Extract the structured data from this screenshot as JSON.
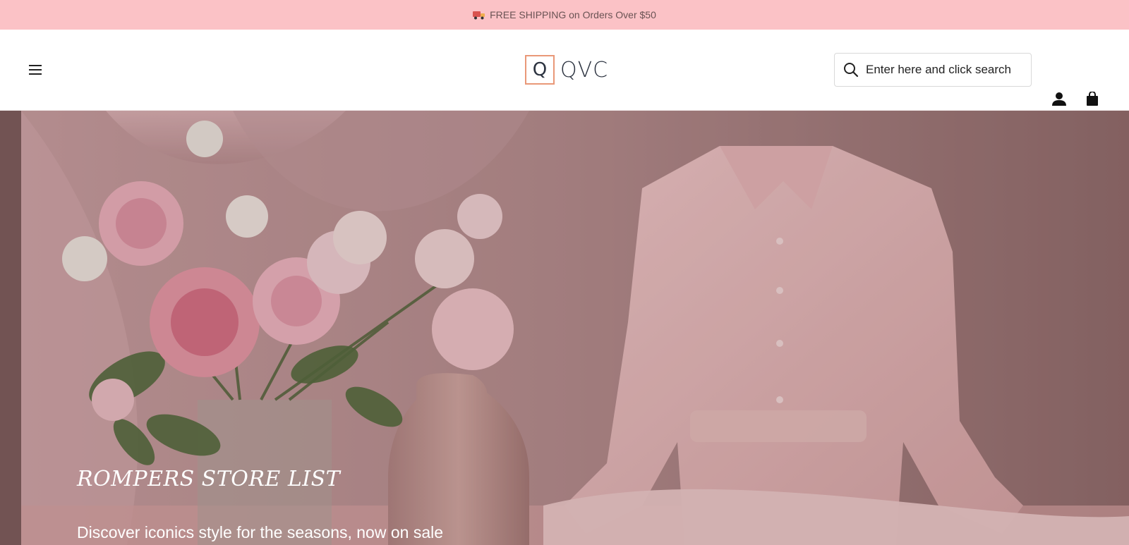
{
  "announcement": {
    "text": "FREE SHIPPING on Orders Over $50",
    "icon": "truck-icon"
  },
  "header": {
    "logo_mark": "Q",
    "logo_text": "QVC",
    "search": {
      "placeholder": "Enter here and click search",
      "value": ""
    }
  },
  "hero": {
    "title": "ROMPERS STORE LIST",
    "subtitle": "Discover iconics style for the seasons, now on sale"
  },
  "colors": {
    "announcement_bg": "#fbc2c6",
    "logo_border": "#e99878",
    "hero_tone": "#c79b9b"
  }
}
